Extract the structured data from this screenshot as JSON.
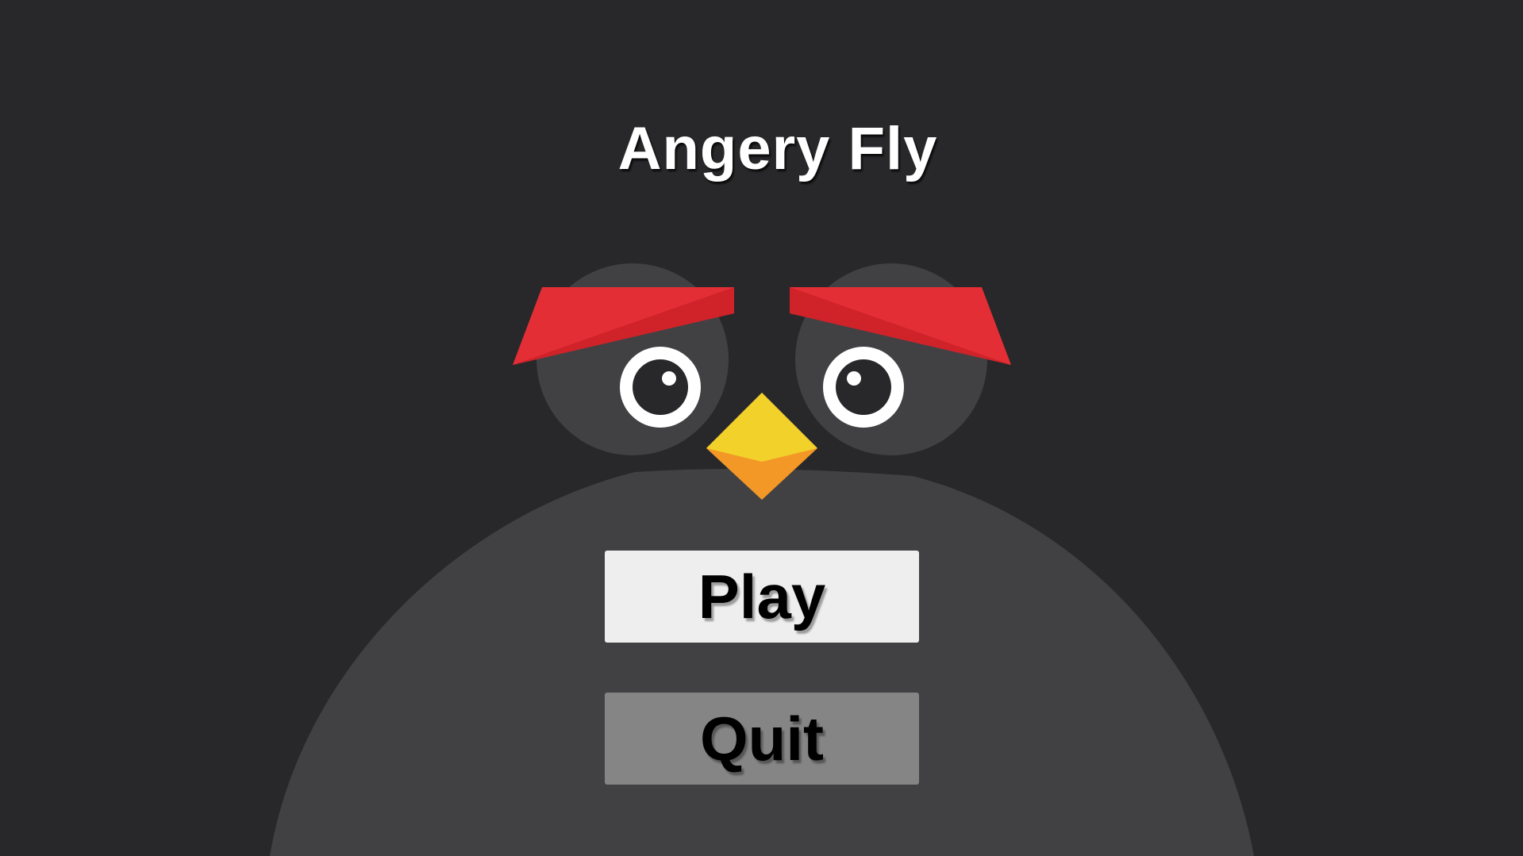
{
  "game": {
    "title": "Angery Fly"
  },
  "menu": {
    "play_label": "Play",
    "quit_label": "Quit"
  },
  "colors": {
    "background": "#28282a",
    "bird_body": "#414143",
    "brow_red": "#e42e36",
    "brow_shadow": "#cf2229",
    "beak_top": "#f2d12b",
    "beak_bottom": "#f39726",
    "eye_white": "#ffffff",
    "pupil": "#28282a",
    "play_button": "#eeeeee",
    "quit_button": "#858585"
  }
}
